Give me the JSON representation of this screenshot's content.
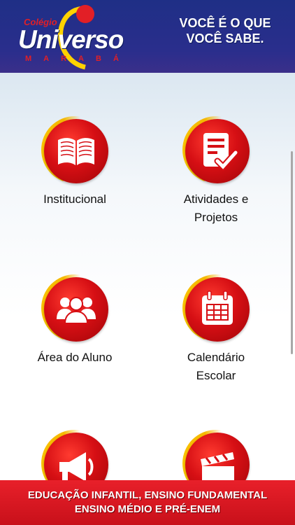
{
  "header": {
    "logo_small": "Colégio",
    "logo_main": "Universo",
    "logo_sub": "MARABÁ",
    "tagline_line1": "VOCÊ É O QUE",
    "tagline_line2": "VOCÊ SABE."
  },
  "menu": {
    "items": [
      {
        "label": "Institucional",
        "icon": "book-icon"
      },
      {
        "label": "Atividades e Projetos",
        "icon": "checklist-document-icon"
      },
      {
        "label": "Área do Aluno",
        "icon": "group-users-icon"
      },
      {
        "label": "Calendário Escolar",
        "icon": "calendar-icon"
      },
      {
        "label": "",
        "icon": "megaphone-icon"
      },
      {
        "label": "",
        "icon": "clapperboard-icon"
      }
    ]
  },
  "footer": {
    "line1": "EDUCAÇÃO INFANTIL, ENSINO FUNDAMENTAL",
    "line2": "ENSINO MÉDIO E PRÉ-ENEM"
  },
  "colors": {
    "header_bg": "#1f2f86",
    "badge_red": "#d60f14",
    "badge_ring": "#ffd200",
    "footer_bg": "#e8202a"
  }
}
